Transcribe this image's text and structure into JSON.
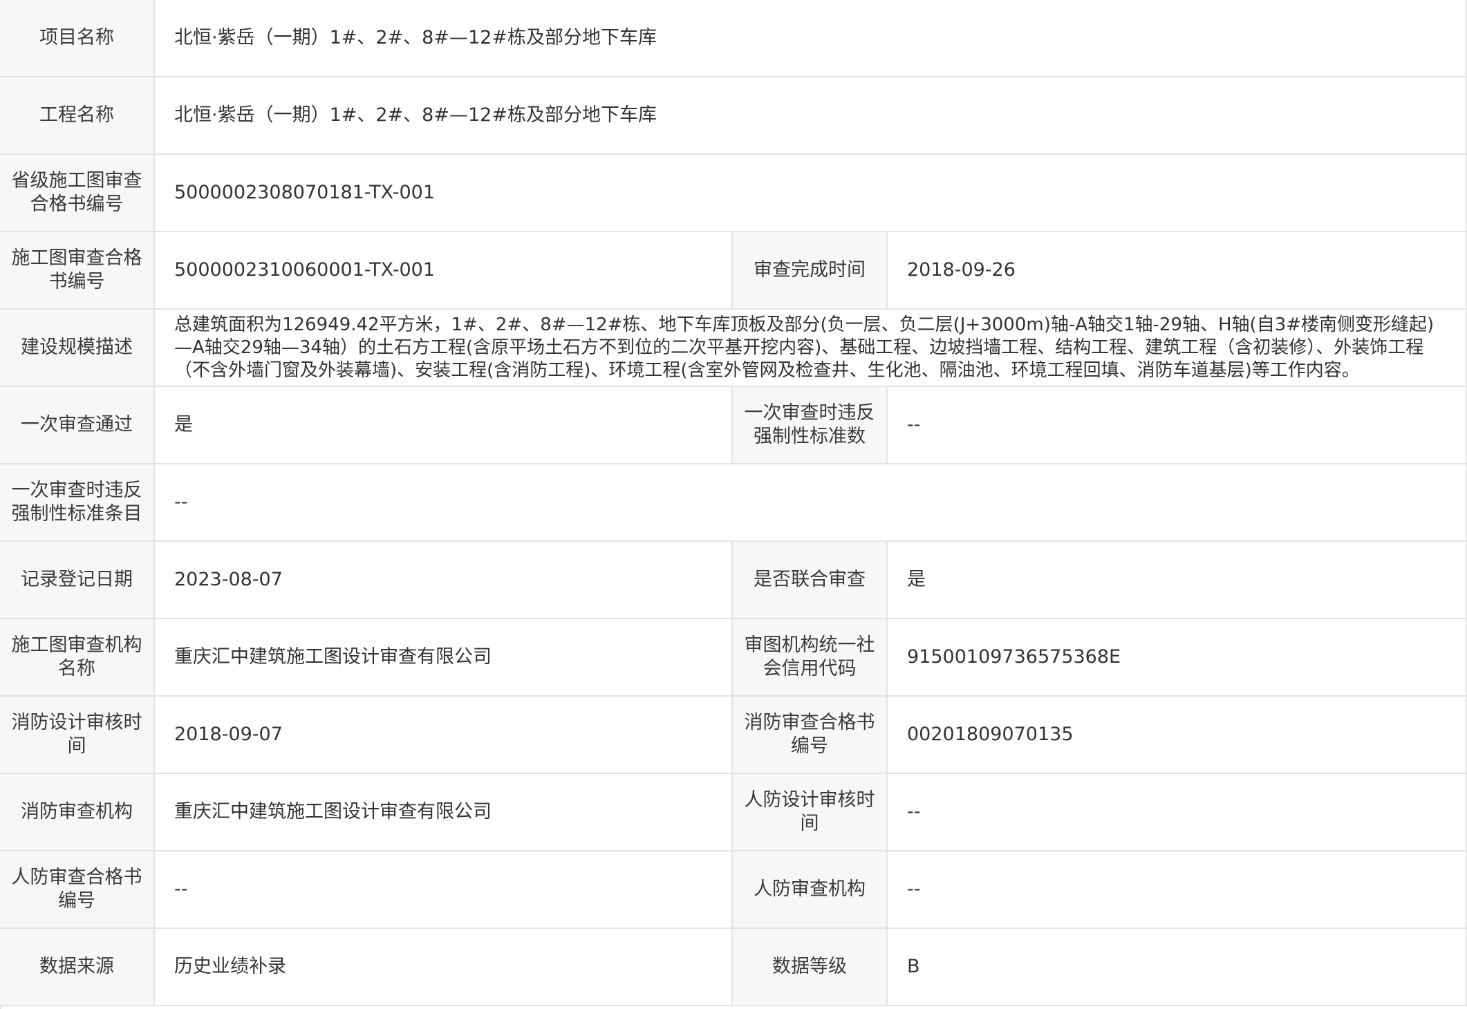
{
  "rows": [
    {
      "label": "项目名称",
      "value": "北恒·紫岳（一期）1#、2#、8#—12#栋及部分地下车库"
    },
    {
      "label": "工程名称",
      "value": "北恒·紫岳（一期）1#、2#、8#—12#栋及部分地下车库"
    },
    {
      "label": "省级施工图审查合格书编号",
      "value": "5000002308070181-TX-001"
    },
    {
      "label": "施工图审查合格书编号",
      "value": "5000002310060001-TX-001",
      "label2": "审查完成时间",
      "value2": "2018-09-26"
    },
    {
      "label": "建设规模描述",
      "value": "总建筑面积为126949.42平方米，1#、2#、8#—12#栋、地下车库顶板及部分(负一层、负二层(J+3000m)轴-A轴交1轴-29轴、H轴(自3#楼南侧变形缝起)—A轴交29轴—34轴）的土石方工程(含原平场土石方不到位的二次平基开挖内容)、基础工程、边坡挡墙工程、结构工程、建筑工程（含初装修）、外装饰工程（不含外墙门窗及外装幕墙)、安装工程(含消防工程)、环境工程(含室外管网及检查井、生化池、隔油池、环境工程回填、消防车道基层)等工作内容。"
    },
    {
      "label": "一次审查通过",
      "value": "是",
      "label2": "一次审查时违反强制性标准数",
      "value2": "--"
    },
    {
      "label": "一次审查时违反强制性标准条目",
      "value": "--"
    },
    {
      "label": "记录登记日期",
      "value": "2023-08-07",
      "label2": "是否联合审查",
      "value2": "是"
    },
    {
      "label": "施工图审查机构名称",
      "value": "重庆汇中建筑施工图设计审查有限公司",
      "label2": "审图机构统一社会信用代码",
      "value2": "91500109736575368E"
    },
    {
      "label": "消防设计审核时间",
      "value": "2018-09-07",
      "label2": "消防审查合格书编号",
      "value2": "00201809070135"
    },
    {
      "label": "消防审查机构",
      "value": "重庆汇中建筑施工图设计审查有限公司",
      "label2": "人防设计审核时间",
      "value2": "--"
    },
    {
      "label": "人防审查合格书编号",
      "value": "--",
      "label2": "人防审查机构",
      "value2": "--"
    },
    {
      "label": "数据来源",
      "value": "历史业绩补录",
      "label2": "数据等级",
      "value2": "B"
    }
  ]
}
